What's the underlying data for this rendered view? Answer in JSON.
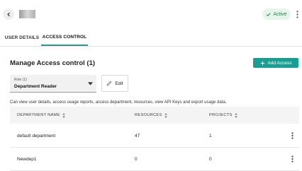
{
  "header": {
    "status_badge": "Active"
  },
  "tabs": [
    {
      "label": "USER DETAILS"
    },
    {
      "label": "ACCESS CONTROL"
    }
  ],
  "section": {
    "title": "Manage Access control (1)",
    "add_button": "Add Access"
  },
  "role": {
    "label": "Role (1)",
    "value": "Department Reader"
  },
  "edit_button": "Edit",
  "description": "Can view user details, access usage reports, access department, resources, view API Keys and export usage data.",
  "table": {
    "columns": [
      "DEPARTMENT NAME",
      "RESOURCES",
      "PROJECTS"
    ],
    "rows": [
      [
        "default department",
        "47",
        "1"
      ],
      [
        "Newdep1",
        "0",
        "0"
      ]
    ]
  },
  "colors": {
    "accent": "#1a9e93",
    "status_bg": "#e6f5ec",
    "status_text": "#2e7d4f"
  }
}
